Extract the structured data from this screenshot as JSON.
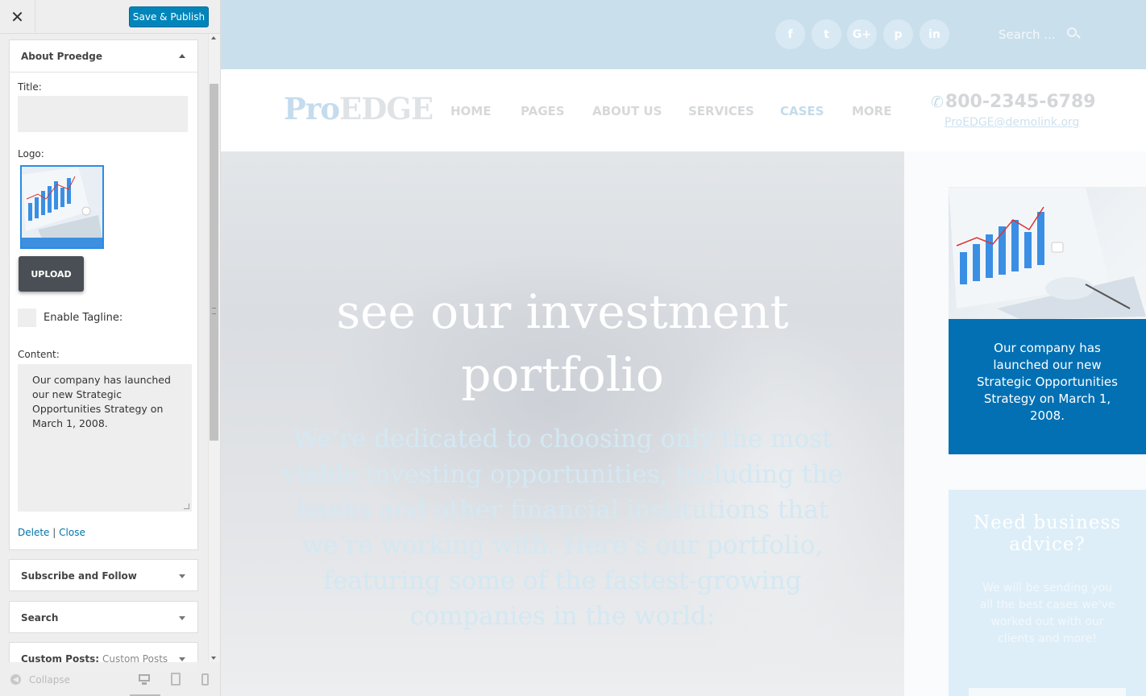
{
  "customizer": {
    "close_icon": "close-icon",
    "publish_label": "Save & Publish",
    "open_widget": {
      "title": "About Proedge",
      "title_label": "Title:",
      "title_value": "",
      "logo_label": "Logo:",
      "upload_label": "UPLOAD",
      "tagline_label": "Enable Tagline:",
      "tagline_checked": false,
      "content_label": "Content:",
      "content_value": "Our company has launched our new Strategic Opportunities Strategy on March 1, 2008.",
      "delete_label": "Delete",
      "separator": "|",
      "close_label": "Close"
    },
    "widgets": [
      {
        "title": "Subscribe and Follow",
        "sub": ""
      },
      {
        "title": "Search",
        "sub": ""
      },
      {
        "title": "Custom Posts:",
        "sub": "Custom Posts"
      }
    ],
    "footer": {
      "collapse_label": "Collapse",
      "devices": [
        "desktop-icon",
        "tablet-icon",
        "mobile-icon"
      ],
      "active_device": "desktop"
    }
  },
  "site": {
    "social": [
      "f",
      "t",
      "G+",
      "p",
      "in"
    ],
    "search_placeholder": "Search ...",
    "logo_pro": "Pro",
    "logo_edge": "EDGE",
    "nav": [
      {
        "label": "HOME",
        "active": false
      },
      {
        "label": "PAGES",
        "active": false
      },
      {
        "label": "ABOUT US",
        "active": false
      },
      {
        "label": "SERVICES",
        "active": false
      },
      {
        "label": "CASES",
        "active": true
      },
      {
        "label": "MORE",
        "active": false
      }
    ],
    "phone": "800-2345-6789",
    "email": "ProEDGE@demolink.org",
    "hero_title_line1": "see our investment",
    "hero_title_line2": "portfolio",
    "hero_subtitle": "We’re dedicated to choosing only the most viable investing opportunities, including the banks and other financial institutions that we’re working with. Here’s our portfolio, featuring some of the fastest-growing companies in the world:",
    "promo_text": "Our company has launched our new Strategic Opportunities Strategy on March 1, 2008.",
    "advice_title": "Need business advice?",
    "advice_text": "We will be sending you all the best cases we've worked out with our clients and more!"
  },
  "colors": {
    "publish": "#0085ba",
    "accent_blue": "#0270b3",
    "topstrip": "#c9dfec"
  }
}
